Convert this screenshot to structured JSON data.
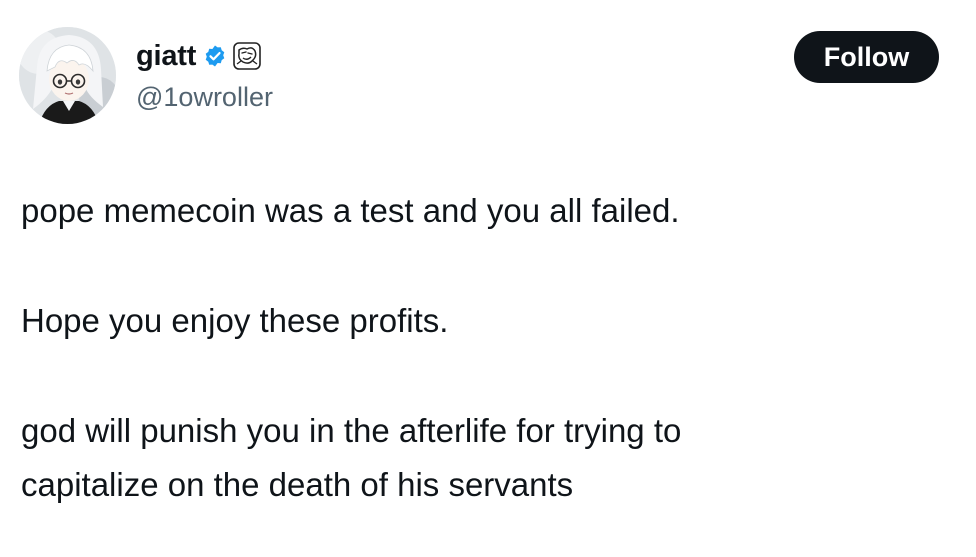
{
  "author": {
    "display_name": "giatt",
    "handle": "@1owroller",
    "verified_icon": "verified-badge-icon",
    "affiliate_icon": "affiliate-logo-icon",
    "avatar": "anime-avatar",
    "verified_color": "#1d9bf0"
  },
  "actions": {
    "follow_label": "Follow"
  },
  "tweet": {
    "paragraphs": [
      "pope memecoin was a test and you all failed.",
      "Hope you enjoy these profits.",
      "god will punish you in the afterlife for trying to",
      "capitalize on the death of his servants"
    ]
  }
}
